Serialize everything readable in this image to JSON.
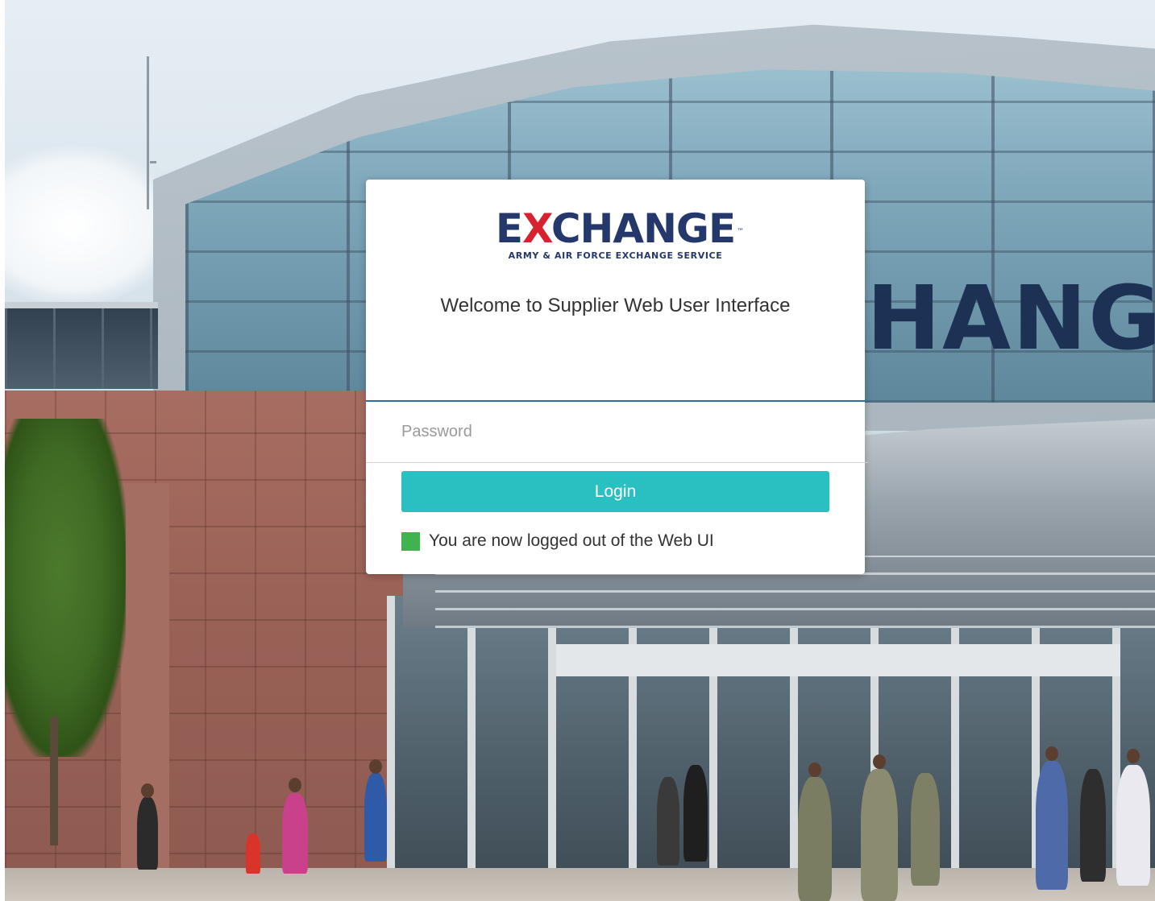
{
  "background": {
    "storefront_sign": "HANGE"
  },
  "login": {
    "logo": {
      "word_pre": "E",
      "word_x": "X",
      "word_post": "CHANGE",
      "trademark": "™",
      "subtitle": "ARMY & AIR FORCE EXCHANGE SERVICE"
    },
    "welcome_text": "Welcome to Supplier Web User Interface",
    "username": {
      "value": "",
      "placeholder": ""
    },
    "password": {
      "value": "",
      "placeholder": "Password"
    },
    "login_button_label": "Login",
    "status": {
      "message": "You are now logged out of the Web UI",
      "color": "#3fb34f"
    },
    "accent_color": "#2abfc0",
    "brand_navy": "#24386b",
    "brand_red": "#d6232f"
  }
}
